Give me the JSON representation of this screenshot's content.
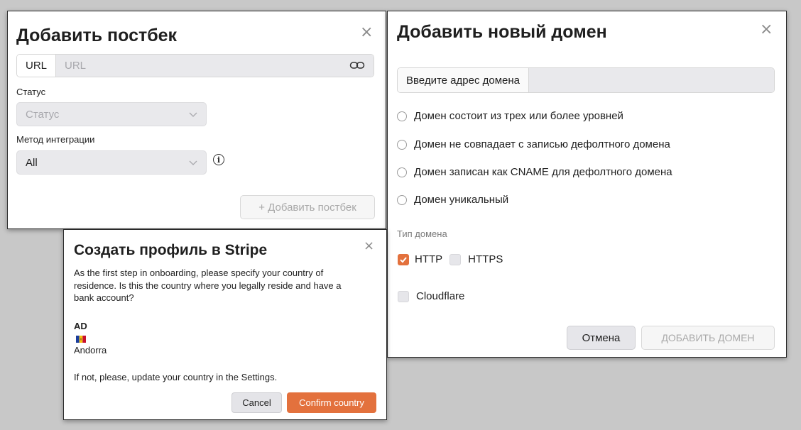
{
  "postback": {
    "title": "Добавить постбек",
    "close": "×",
    "url_addon": "URL",
    "url_placeholder": "URL",
    "status_label": "Статус",
    "status_placeholder": "Статус",
    "method_label": "Метод интеграции",
    "method_value": "All",
    "info": "i",
    "add_button": "+ Добавить постбек"
  },
  "domain": {
    "title": "Добавить новый домен",
    "close": "×",
    "address_addon": "Введите адрес домена",
    "address_value": "",
    "checks": [
      "Домен состоит из трех или более уровней",
      "Домен не совпадает с записью дефолтного домена",
      "Домен записан как CNAME для дефолтного домена",
      "Домен уникальный"
    ],
    "type_label": "Тип домена",
    "http_label": "HTTP",
    "http_checked": true,
    "https_label": "HTTPS",
    "https_checked": false,
    "cloudflare_label": "Cloudflare",
    "cloudflare_checked": false,
    "cancel_button": "Отмена",
    "add_button": "ДОБАВИТЬ ДОМЕН"
  },
  "stripe": {
    "title": "Создать профиль в Stripe",
    "close": "×",
    "intro": "As the first step in onboarding, please specify your country of residence. Is this the country where you legally reside and have a bank account?",
    "country_code": "AD",
    "country_name": "Andorra",
    "note": "If not, please, update your country in the Settings.",
    "cancel_button": "Cancel",
    "confirm_button": "Confirm country"
  },
  "colors": {
    "accent": "#e3713d",
    "backdrop": "#c8c8c8"
  }
}
